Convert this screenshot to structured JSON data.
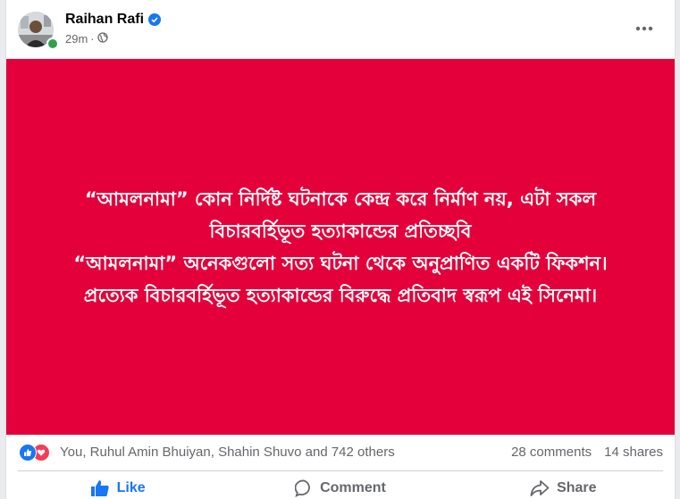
{
  "post": {
    "author_name": "Raihan Rafi",
    "timestamp": "29m",
    "separator": "·",
    "privacy_icon": "globe-icon",
    "verified_icon": "verified-badge-icon",
    "more_icon": "more-horizontal-icon"
  },
  "media": {
    "background_color": "#e4003b",
    "text_color": "#ffffff",
    "lines": [
      "“আমলনামা” কোন নির্দিষ্ট ঘটনাকে কেন্দ্র করে নির্মাণ নয়, এটা সকল",
      "বিচারবর্হিভূত হত্যাকান্ডের প্রতিচ্ছবি",
      "“আমলনামা” অনেকগুলো সত্য ঘটনা থেকে অনুপ্রাণিত একটি ফিকশন।",
      "প্রত্যেক বিচারবর্হিভূত হত্যাকান্ডের বিরুদ্ধে প্রতিবাদ স্বরূপ এই সিনেমা।"
    ]
  },
  "reactions": {
    "icons": [
      "like-reaction-icon",
      "love-reaction-icon"
    ],
    "summary": "You, Ruhul Amin Bhuiyan, Shahin Shuvo and 742 others",
    "comments": "28 comments",
    "shares": "14 shares"
  },
  "actions": {
    "like_label": "Like",
    "comment_label": "Comment",
    "share_label": "Share"
  },
  "colors": {
    "accent": "#1877f2",
    "love": "#f33e58",
    "secondary_text": "#65676b",
    "online": "#31a24c"
  }
}
